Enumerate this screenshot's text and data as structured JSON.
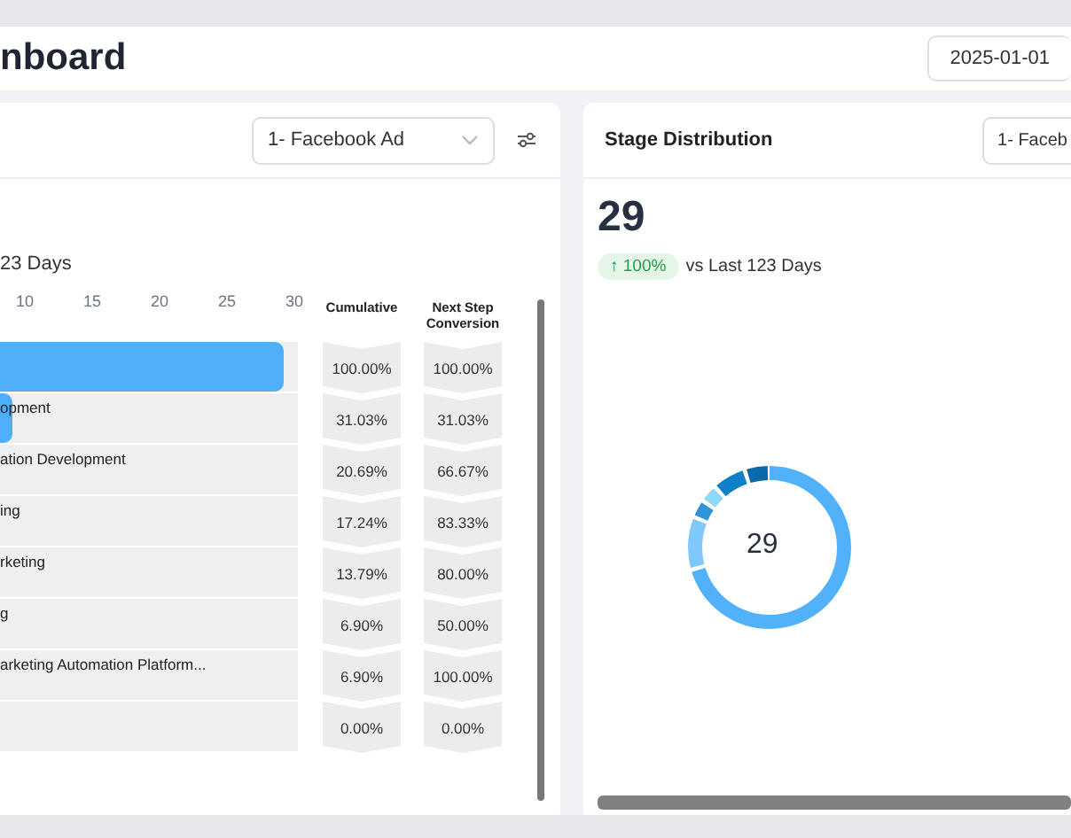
{
  "header": {
    "title": "nboard",
    "date": "2025-01-01"
  },
  "funnel_panel": {
    "dropdown": "1- Facebook Ad",
    "subtitle": "23 Days",
    "axis_labels": [
      "10",
      "15",
      "20",
      "25",
      "30"
    ],
    "columns": [
      "Cumulative",
      "Next Step Conversion"
    ],
    "rows": [
      {
        "level": 0.95,
        "cumulative": "100.00%",
        "next_step": "100.00%"
      },
      {
        "label": "opment",
        "level": 0.04,
        "cumulative": "31.03%",
        "next_step": "31.03%"
      },
      {
        "label": "ation Development",
        "level": 0,
        "cumulative": "20.69%",
        "next_step": "66.67%"
      },
      {
        "label": "ing",
        "level": 0,
        "cumulative": "17.24%",
        "next_step": "83.33%"
      },
      {
        "label": "rketing",
        "level": 0,
        "cumulative": "13.79%",
        "next_step": "80.00%"
      },
      {
        "label": "g",
        "level": 0,
        "cumulative": "6.90%",
        "next_step": "50.00%"
      },
      {
        "label": "arketing Automation Platform...",
        "level": 0,
        "cumulative": "6.90%",
        "next_step": "100.00%"
      },
      {
        "level": 0,
        "cumulative": "0.00%",
        "next_step": "0.00%"
      }
    ]
  },
  "distribution_panel": {
    "title": "Stage Distribution",
    "dropdown": "1- Faceb",
    "total": "29",
    "change": "↑ 100%",
    "comparison": "vs Last 123 Days",
    "donut_center": "29"
  }
}
